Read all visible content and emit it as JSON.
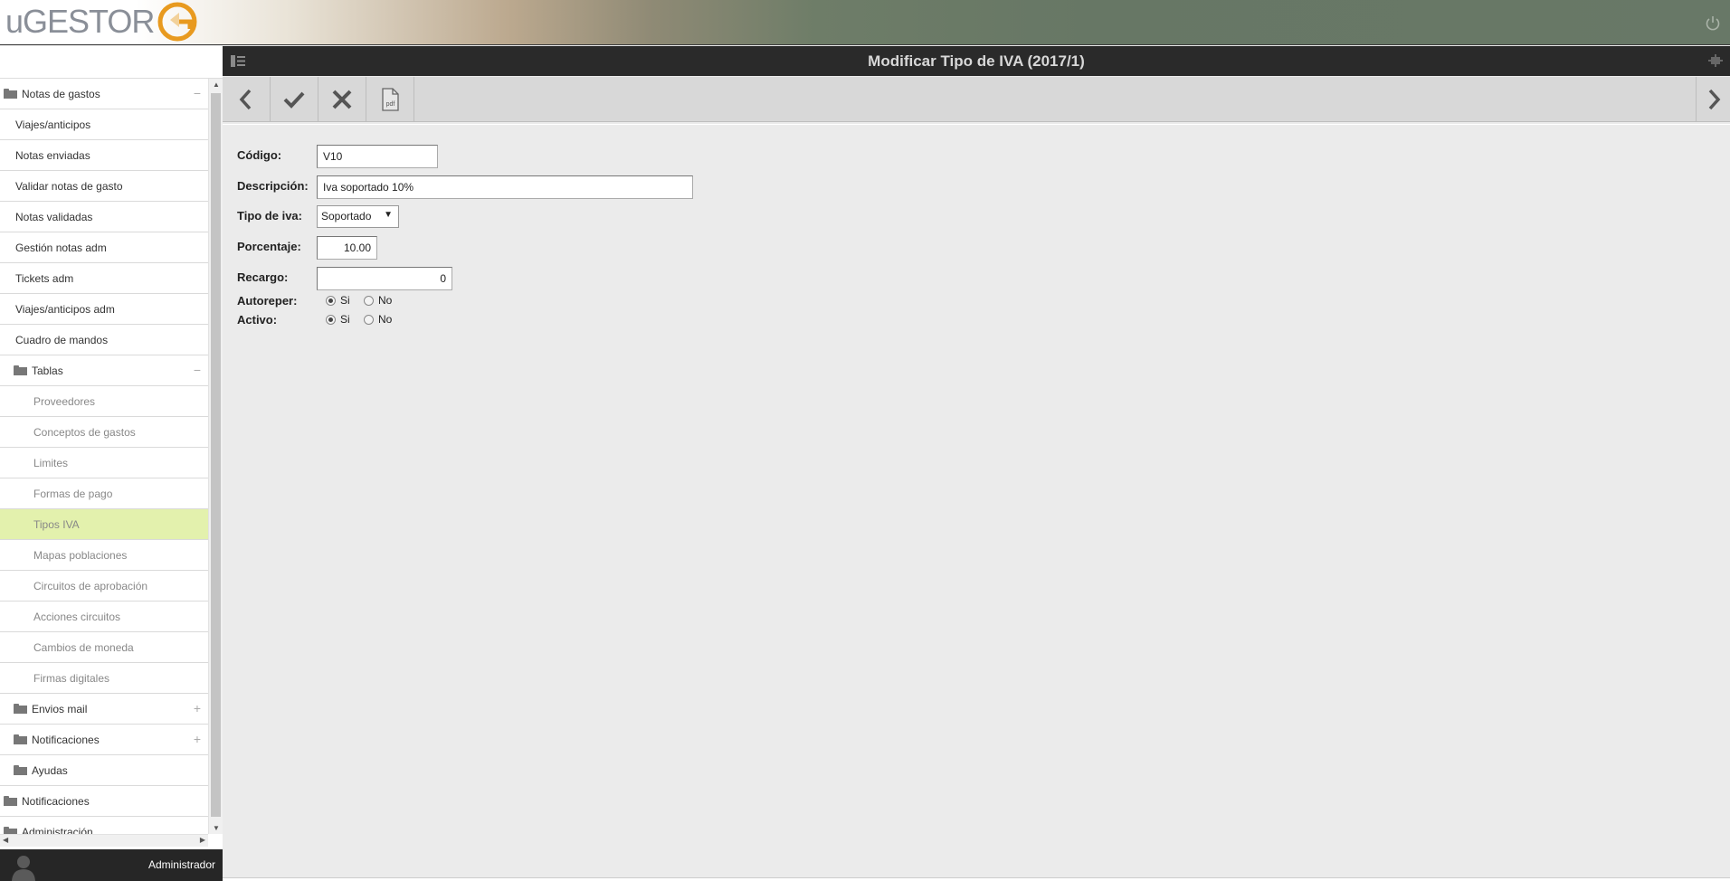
{
  "app": {
    "logo_text": "uGESTOR",
    "user": "Administrador"
  },
  "page": {
    "title": "Modificar Tipo de IVA (2017/1)"
  },
  "sidebar": {
    "items": [
      {
        "label": "Notas de gastos",
        "level": "grp0",
        "folder": true,
        "toggle": "−"
      },
      {
        "label": "Viajes/anticipos",
        "level": "l1"
      },
      {
        "label": "Notas enviadas",
        "level": "l1"
      },
      {
        "label": "Validar notas de gasto",
        "level": "l1"
      },
      {
        "label": "Notas validadas",
        "level": "l1"
      },
      {
        "label": "Gestión notas adm",
        "level": "l1"
      },
      {
        "label": "Tickets adm",
        "level": "l1"
      },
      {
        "label": "Viajes/anticipos adm",
        "level": "l1"
      },
      {
        "label": "Cuadro de mandos",
        "level": "l1"
      },
      {
        "label": "Tablas",
        "level": "grp1",
        "folder": true,
        "toggle": "−"
      },
      {
        "label": "Proveedores",
        "level": "l2"
      },
      {
        "label": "Conceptos de gastos",
        "level": "l2"
      },
      {
        "label": "Limites",
        "level": "l2"
      },
      {
        "label": "Formas de pago",
        "level": "l2"
      },
      {
        "label": "Tipos IVA",
        "level": "l2",
        "active": true
      },
      {
        "label": "Mapas poblaciones",
        "level": "l2"
      },
      {
        "label": "Circuitos de aprobación",
        "level": "l2"
      },
      {
        "label": "Acciones circuitos",
        "level": "l2"
      },
      {
        "label": "Cambios de moneda",
        "level": "l2"
      },
      {
        "label": "Firmas digitales",
        "level": "l2"
      },
      {
        "label": "Envios mail",
        "level": "grp1",
        "folder": true,
        "toggle": "+"
      },
      {
        "label": "Notificaciones",
        "level": "grp1",
        "folder": true,
        "toggle": "+"
      },
      {
        "label": "Ayudas",
        "level": "grp1",
        "folder": true
      },
      {
        "label": "Notificaciones",
        "level": "grp0",
        "folder": true
      },
      {
        "label": "Administración",
        "level": "grp0",
        "folder": true
      }
    ]
  },
  "toolbar": {
    "buttons": [
      {
        "name": "back-button",
        "icon": "chevron-left-icon"
      },
      {
        "name": "accept-button",
        "icon": "check-icon"
      },
      {
        "name": "cancel-button",
        "icon": "close-icon"
      },
      {
        "name": "pdf-button",
        "icon": "pdf-icon",
        "text": "pdf"
      }
    ]
  },
  "form": {
    "codigo": {
      "label": "Código:",
      "value": "V10"
    },
    "descripcion": {
      "label": "Descripción:",
      "value": "Iva soportado 10%"
    },
    "tipo_iva": {
      "label": "Tipo de iva:",
      "value": "Soportado"
    },
    "porcentaje": {
      "label": "Porcentaje:",
      "value": "10.00"
    },
    "recargo": {
      "label": "Recargo:",
      "value": "0"
    },
    "autoreper": {
      "label": "Autoreper:",
      "yes": "Si",
      "no": "No",
      "selected": "yes"
    },
    "activo": {
      "label": "Activo:",
      "yes": "Si",
      "no": "No",
      "selected": "yes"
    }
  },
  "colors": {
    "active_item": "#e3f1ad",
    "titlebar": "#2a2a2a",
    "logo_orange": "#e89a1f"
  }
}
